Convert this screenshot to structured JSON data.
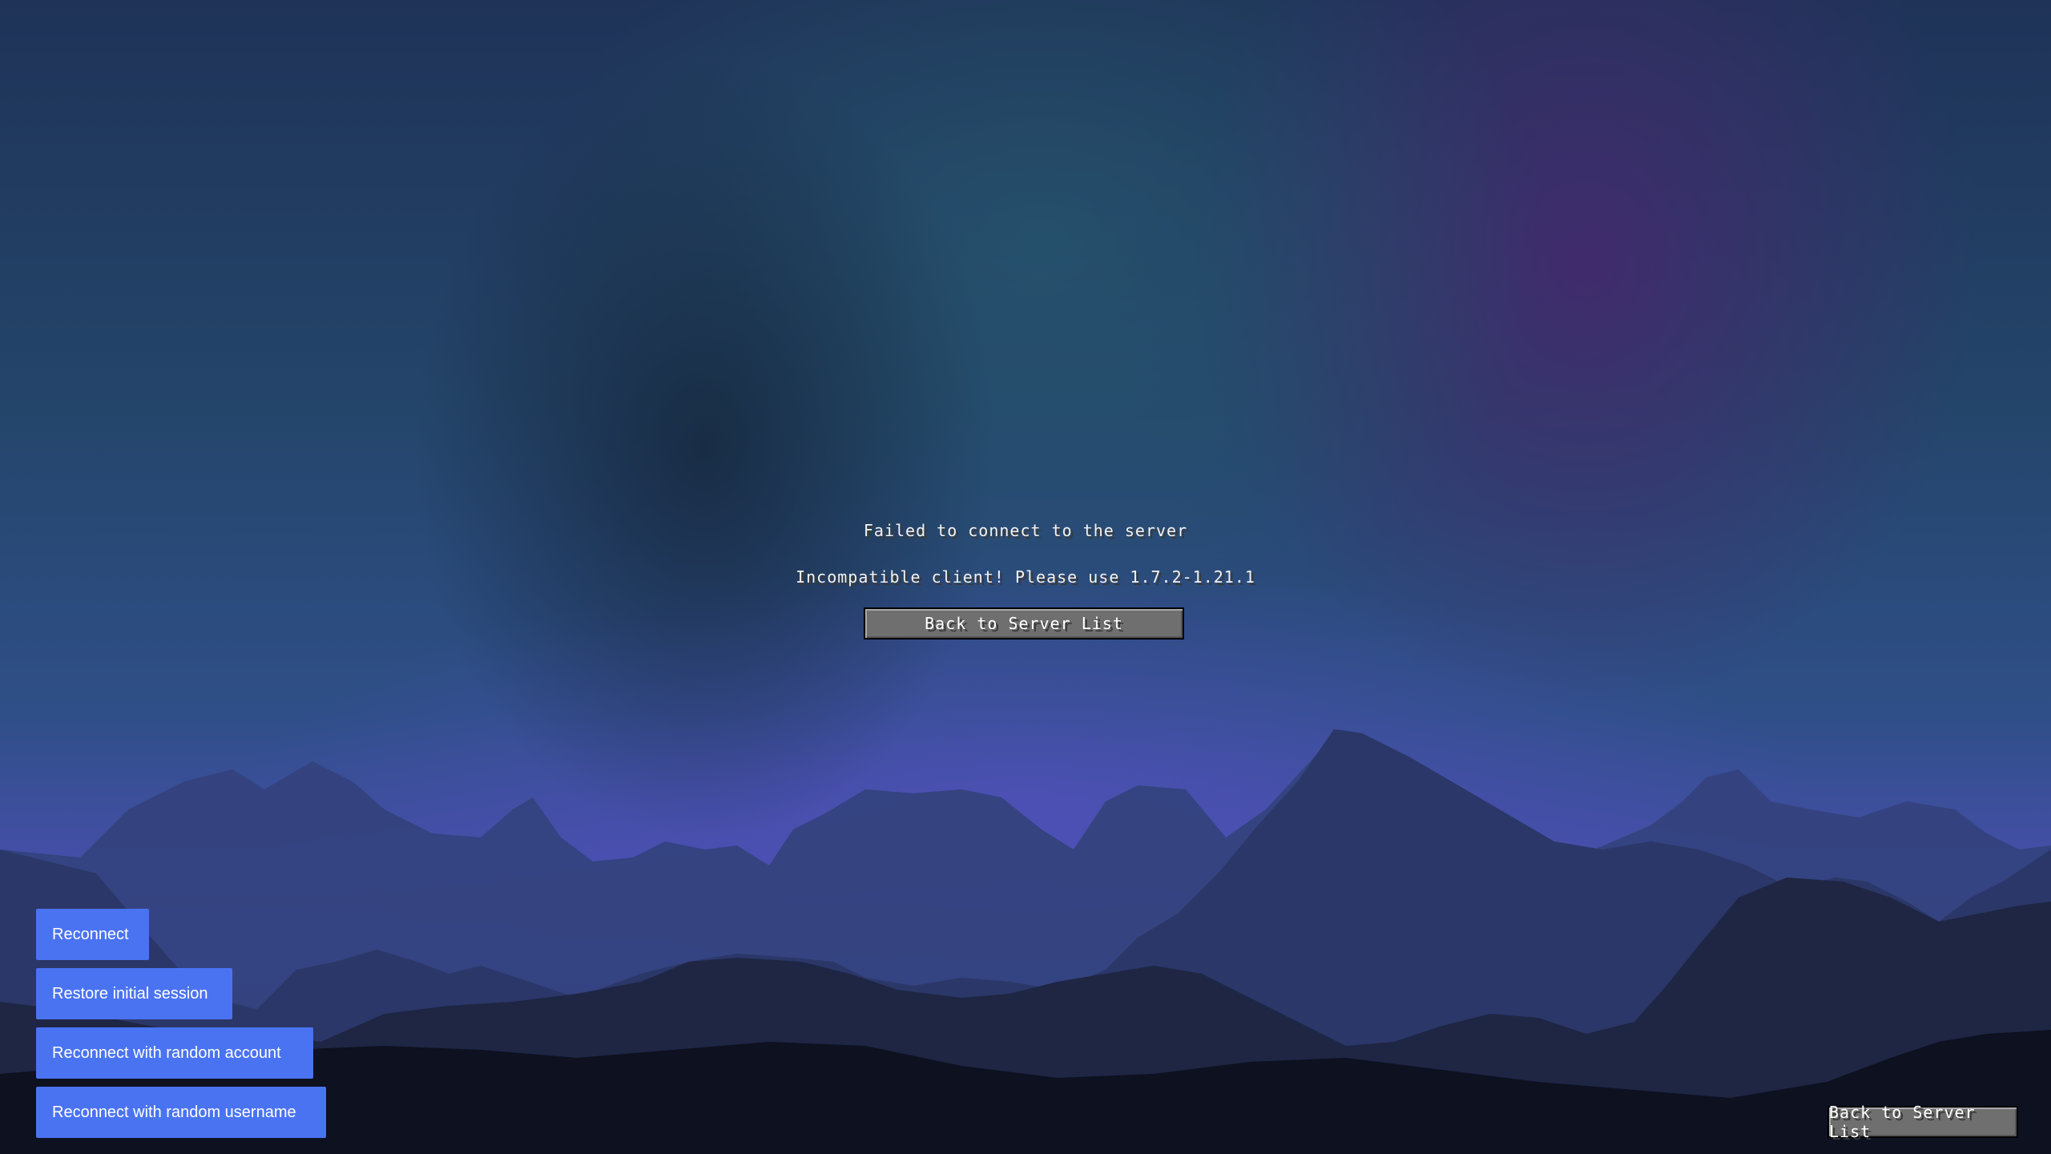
{
  "screen": {
    "title": "Failed to connect to the server",
    "message": "Incompatible client! Please use 1.7.2-1.21.1",
    "back_button_label": "Back to Server List",
    "corner_back_button_label": "Back to Server List"
  },
  "side_buttons": {
    "reconnect": "Reconnect",
    "restore_session": "Restore initial session",
    "random_account": "Reconnect with random account",
    "random_username": "Reconnect with random username"
  },
  "colors": {
    "side_button": "#4a73f2",
    "mc_button": "#6f6f6f",
    "sky_top": "#1f3358",
    "sky_glow": "#4a4fb0"
  }
}
